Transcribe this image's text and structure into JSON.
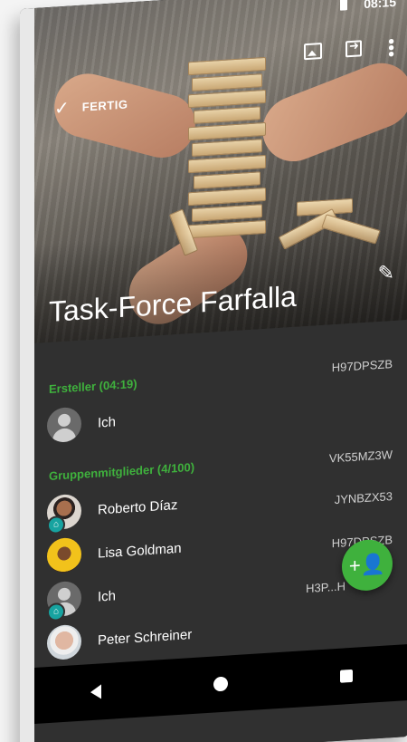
{
  "status": {
    "time": "08:15"
  },
  "toolbar": {
    "done_label": "FERTIG"
  },
  "group": {
    "title": "Task-Force Farfalla"
  },
  "creator_section": {
    "label": "Ersteller (04:19)",
    "code": "H97DPSZB"
  },
  "creator": {
    "name": "Ich"
  },
  "members_section": {
    "label": "Gruppenmitglieder (4/100)",
    "code": "VK55MZ3W"
  },
  "members": [
    {
      "name": "Roberto Díaz",
      "code": "JYNBZX53"
    },
    {
      "name": "Lisa Goldman",
      "code": "H97DPSZB"
    },
    {
      "name": "Ich",
      "code": "H3P...H"
    },
    {
      "name": "Peter Schreiner",
      "code": ""
    }
  ],
  "colors": {
    "accent": "#3fb13d",
    "background": "#303030"
  }
}
